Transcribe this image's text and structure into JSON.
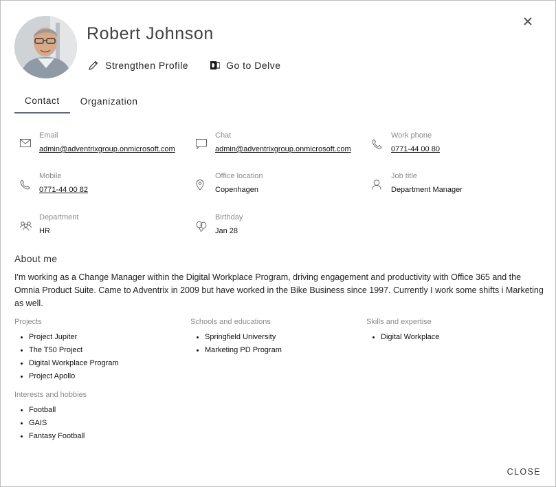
{
  "profile": {
    "name": "Robert Johnson",
    "strengthen_label": "Strengthen Profile",
    "delve_label": "Go to Delve"
  },
  "tabs": [
    {
      "label": "Contact",
      "active": true
    },
    {
      "label": "Organization",
      "active": false
    }
  ],
  "contact": {
    "email": {
      "label": "Email",
      "value": "admin@adventrixgroup.onmicrosoft.com"
    },
    "chat": {
      "label": "Chat",
      "value": "admin@adventrixgroup.onmicrosoft.com"
    },
    "work_phone": {
      "label": "Work phone",
      "value": "0771-44 00 80"
    },
    "mobile": {
      "label": "Mobile",
      "value": "0771-44 00 82"
    },
    "office": {
      "label": "Office location",
      "value": "Copenhagen"
    },
    "job_title": {
      "label": "Job title",
      "value": "Department Manager"
    },
    "department": {
      "label": "Department",
      "value": "HR"
    },
    "birthday": {
      "label": "Birthday",
      "value": "Jan 28"
    }
  },
  "about": {
    "heading": "About me",
    "text": "I'm working as a Change Manager within the Digital Workplace Program, driving engagement and productivity with Office 365 and the Omnia Product Suite. Came to Adventrix in 2009 but have worked in the Bike Business since 1997. Currently I work some shifts i Marketing as well."
  },
  "projects": {
    "title": "Projects",
    "items": [
      "Project Jupiter",
      "The T50 Project",
      "Digital Workplace Program",
      "Project Apollo"
    ]
  },
  "schools": {
    "title": "Schools and educations",
    "items": [
      "Springfield University",
      "Marketing PD Program"
    ]
  },
  "skills": {
    "title": "Skills and expertise",
    "items": [
      "Digital Workplace"
    ]
  },
  "interests": {
    "title": "Interests and hobbies",
    "items": [
      "Football",
      "GAIS",
      "Fantasy Football"
    ]
  },
  "footer": {
    "close_label": "CLOSE"
  }
}
